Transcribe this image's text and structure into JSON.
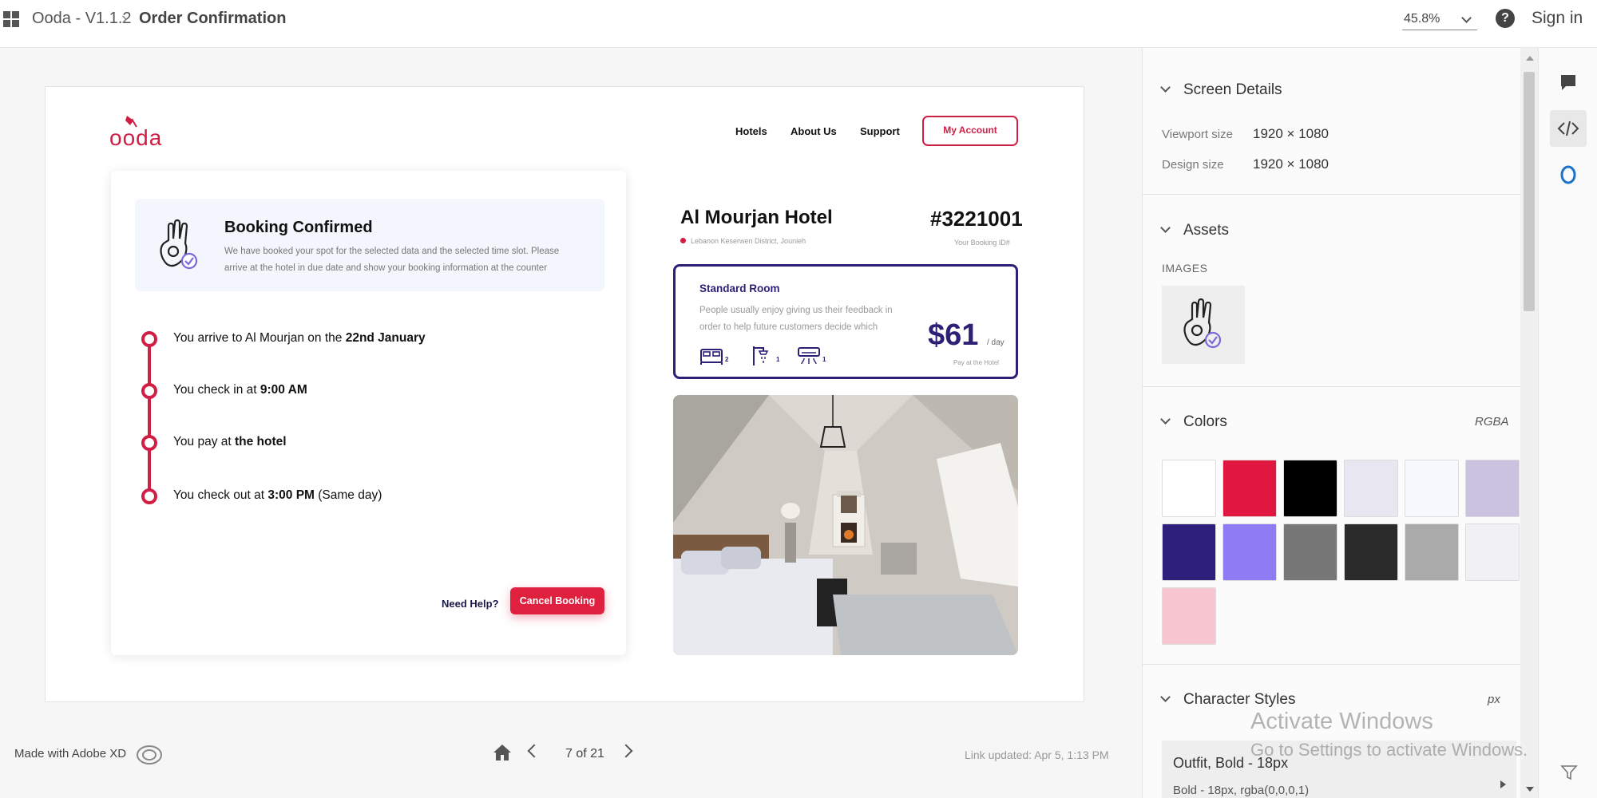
{
  "topbar": {
    "app_title": "Ooda - V1.1.2",
    "page_title": "Order Confirmation",
    "zoom": "45.8%",
    "sign_in": "Sign in"
  },
  "preview": {
    "logo_text": "ooda",
    "nav": [
      "Hotels",
      "About Us",
      "Support"
    ],
    "my_account": "My Account",
    "confirmation": {
      "title": "Booking Confirmed",
      "description": "We have booked your spot for the selected data and the selected time slot. Please arrive at the hotel in due date and show your booking information at the counter"
    },
    "timeline": [
      {
        "prefix": "You arrive to Al Mourjan on the ",
        "bold": "22nd January",
        "suffix": ""
      },
      {
        "prefix": "You check in at ",
        "bold": "9:00 AM",
        "suffix": ""
      },
      {
        "prefix": "You pay at ",
        "bold": "the hotel",
        "suffix": ""
      },
      {
        "prefix": "You check out at ",
        "bold": "3:00 PM",
        "suffix": " (Same day)"
      }
    ],
    "need_help": "Need Help?",
    "cancel_booking": "Cancel Booking",
    "hotel": {
      "name": "Al Mourjan Hotel",
      "location": "Lebanon Keserwen District, Jounieh",
      "booking_id": "#3221001",
      "booking_id_label": "Your Booking ID#"
    },
    "room": {
      "title": "Standard Room",
      "description": "People usually enjoy giving us their feedback in order to help future customers decide which",
      "amenities": [
        {
          "icon": "bed-icon",
          "count": "2"
        },
        {
          "icon": "shower-icon",
          "count": "1"
        },
        {
          "icon": "air-conditioner-icon",
          "count": "1"
        }
      ],
      "price": "$61",
      "per": "/ day",
      "pay_note": "Pay at the Hotel"
    }
  },
  "bottombar": {
    "made_with": "Made with Adobe XD",
    "page": "7 of 21",
    "link_updated": "Link updated: Apr 5, 1:13 PM"
  },
  "panel": {
    "screen_details": {
      "title": "Screen Details",
      "viewport_label": "Viewport size",
      "viewport_value": "1920 × 1080",
      "design_label": "Design size",
      "design_value": "1920 × 1080"
    },
    "assets": {
      "title": "Assets",
      "images_label": "IMAGES"
    },
    "colors": {
      "title": "Colors",
      "mode": "RGBA",
      "swatches": [
        "#ffffff",
        "#e0173f",
        "#000000",
        "#e8e6f0",
        "#f5f8fd",
        "#c9c3df",
        "#2d1f7a",
        "#8f7cf4",
        "#777777",
        "#2b2b2b",
        "#aaaaaa",
        "#f1f1f3",
        "#f7c6d0"
      ]
    },
    "character_styles": {
      "title": "Character Styles",
      "unit": "px",
      "style_name": "Outfit, Bold - 18px",
      "style_detail": "Bold - 18px, rgba(0,0,0,1)"
    }
  },
  "watermark": {
    "line1": "Activate Windows",
    "line2": "Go to Settings to activate Windows."
  }
}
